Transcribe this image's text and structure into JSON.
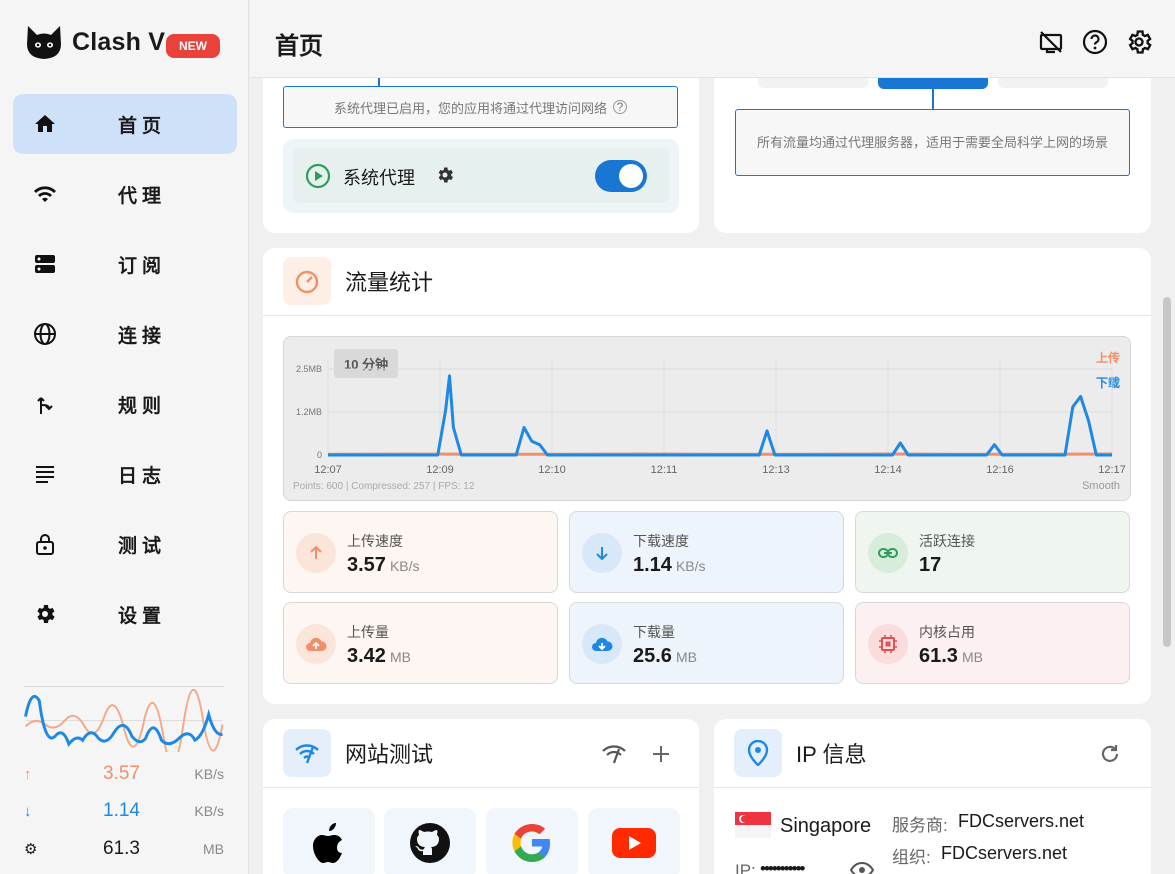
{
  "app": {
    "name": "Clash V",
    "badge": "NEW"
  },
  "nav": [
    {
      "label": "首页",
      "icon": "home-icon",
      "active": true
    },
    {
      "label": "代理",
      "icon": "wifi-icon"
    },
    {
      "label": "订阅",
      "icon": "subscription-icon"
    },
    {
      "label": "连接",
      "icon": "globe-icon"
    },
    {
      "label": "规则",
      "icon": "fork-icon"
    },
    {
      "label": "日志",
      "icon": "log-icon"
    },
    {
      "label": "测试",
      "icon": "lock-icon"
    },
    {
      "label": "设置",
      "icon": "gear-icon"
    }
  ],
  "sidebar_stats": {
    "upload": {
      "value": "3.57",
      "unit": "KB/s"
    },
    "download": {
      "value": "1.14",
      "unit": "KB/s"
    },
    "memory": {
      "value": "61.3",
      "unit": "MB"
    }
  },
  "header": {
    "title": "首页"
  },
  "system_proxy": {
    "hint": "系统代理已启用，您的应用将通过代理访问网络",
    "label": "系统代理",
    "enabled": true
  },
  "proxy_mode": {
    "description": "所有流量均通过代理服务器，适用于需要全局科学上网的场景"
  },
  "traffic": {
    "title": "流量统计",
    "range_label": "10 分钟",
    "legend_upload": "上传",
    "legend_download": "下载",
    "footer": "Points: 600 | Compressed: 257 | FPS: 12",
    "smooth_label": "Smooth",
    "colors": {
      "upload": "#f0906a",
      "download": "#1e88e5"
    }
  },
  "chart_data": {
    "type": "line",
    "y_tick_labels": [
      "2.5MB",
      "1.2MB",
      "0"
    ],
    "x_tick_labels": [
      "12:07",
      "12:09",
      "12:10",
      "12:11",
      "12:13",
      "12:14",
      "12:16",
      "12:17"
    ],
    "ylim": [
      0,
      2.5
    ],
    "series": [
      {
        "name": "上传",
        "x": [
          0,
          10,
          20,
          30,
          40,
          50,
          60,
          70,
          80,
          90,
          100
        ],
        "values": [
          0.02,
          0.03,
          0.02,
          0.02,
          0.03,
          0.02,
          0.02,
          0.03,
          0.02,
          0.02,
          0.03
        ]
      },
      {
        "name": "下载",
        "x": [
          0,
          14,
          15,
          15.5,
          16,
          17,
          24,
          25,
          26,
          27,
          28,
          55,
          56,
          57,
          72,
          73,
          74,
          84,
          85,
          86,
          94,
          95,
          96,
          97,
          98,
          100
        ],
        "values": [
          0,
          0,
          1.3,
          2.3,
          0.8,
          0,
          0,
          0.8,
          0.4,
          0.3,
          0,
          0,
          0.7,
          0,
          0,
          0.35,
          0,
          0,
          0.3,
          0,
          0,
          1.4,
          1.7,
          1.0,
          0,
          0
        ]
      }
    ]
  },
  "stats": [
    {
      "label": "上传速度",
      "value": "3.57",
      "unit": "KB/s",
      "icon": "arrow-up-icon"
    },
    {
      "label": "下载速度",
      "value": "1.14",
      "unit": "KB/s",
      "icon": "arrow-down-icon"
    },
    {
      "label": "活跃连接",
      "value": "17",
      "unit": "",
      "icon": "link-icon"
    },
    {
      "label": "上传量",
      "value": "3.42",
      "unit": "MB",
      "icon": "cloud-upload-icon"
    },
    {
      "label": "下载量",
      "value": "25.6",
      "unit": "MB",
      "icon": "cloud-download-icon"
    },
    {
      "label": "内核占用",
      "value": "61.3",
      "unit": "MB",
      "icon": "chip-icon"
    }
  ],
  "site_test": {
    "title": "网站测试",
    "sites": [
      "apple-icon",
      "github-icon",
      "google-icon",
      "youtube-icon"
    ]
  },
  "ip_info": {
    "title": "IP 信息",
    "country": "Singapore",
    "ip_label": "IP:",
    "ip_masked": "•••••••••••",
    "isp_label": "服务商:",
    "isp": "FDCservers.net",
    "org_label": "组织:",
    "org": "FDCservers.net"
  }
}
